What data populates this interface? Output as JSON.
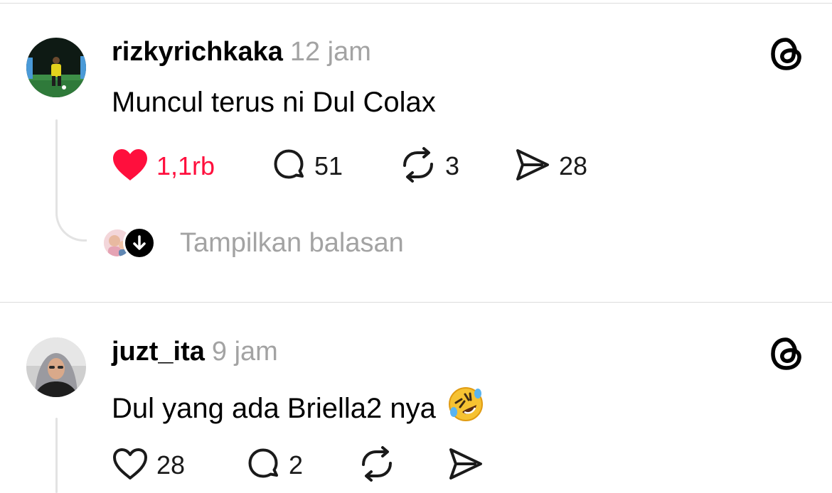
{
  "posts": [
    {
      "username": "rizkyrichkaka",
      "time": "12 jam",
      "text": "Muncul terus ni Dul Colax",
      "liked": true,
      "likes": "1,1rb",
      "comments": "51",
      "reposts": "3",
      "shares": "28",
      "show_replies_label": "Tampilkan balasan",
      "app_logo_icon": "threads-logo-icon"
    },
    {
      "username": "juzt_ita",
      "time": "9 jam",
      "text": "Dul yang ada Briella2 nya",
      "emoji": "rolling-on-the-floor-laughing-emoji",
      "liked": false,
      "likes": "28",
      "comments": "2",
      "reposts": "",
      "shares": "",
      "app_logo_icon": "threads-logo-icon"
    }
  ],
  "colors": {
    "like_active": "#ff0f3d",
    "muted_text": "#a3a3a3",
    "primary_text": "#000000",
    "divider": "#dcdcdc"
  }
}
